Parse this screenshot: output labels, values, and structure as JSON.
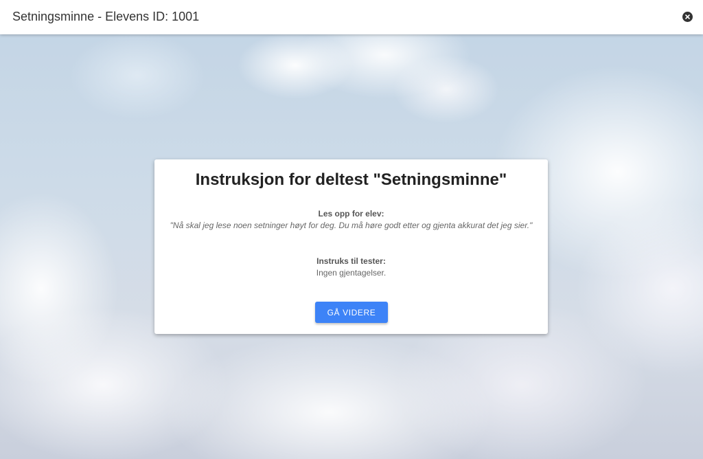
{
  "header": {
    "title": "Setningsminne - Elevens ID: 1001",
    "close_icon": "close-circle-icon"
  },
  "card": {
    "title": "Instruksjon for deltest \"Setningsminne\"",
    "read_heading": "Les opp for elev:",
    "read_text": "\"Nå skal jeg lese noen setninger høyt for deg. Du må høre godt etter og gjenta akkurat det jeg sier.\"",
    "tester_heading": "Instruks til tester:",
    "tester_text": "Ingen gjentagelser.",
    "continue_label": "GÅ VIDERE"
  },
  "colors": {
    "accent": "#3d83f7",
    "header_bg": "#ffffff",
    "title_text": "#222222"
  }
}
